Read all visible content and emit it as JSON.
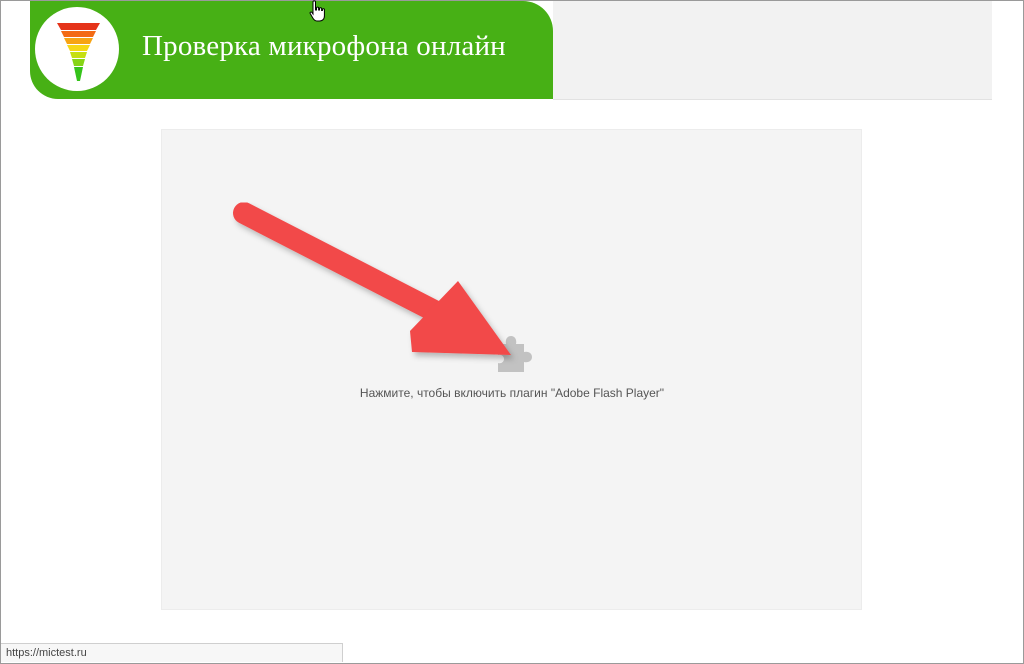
{
  "header": {
    "title": "Проверка микрофона онлайн",
    "logo_icon": "microphone-level-meter-icon",
    "brand_color": "#47b015"
  },
  "plugin": {
    "icon": "puzzle-piece-icon",
    "message": "Нажмите, чтобы включить плагин \"Adobe Flash Player\""
  },
  "annotation": {
    "icon": "red-arrow-icon",
    "color": "#f24a4a"
  },
  "status_bar": {
    "url": "https://mictest.ru"
  }
}
